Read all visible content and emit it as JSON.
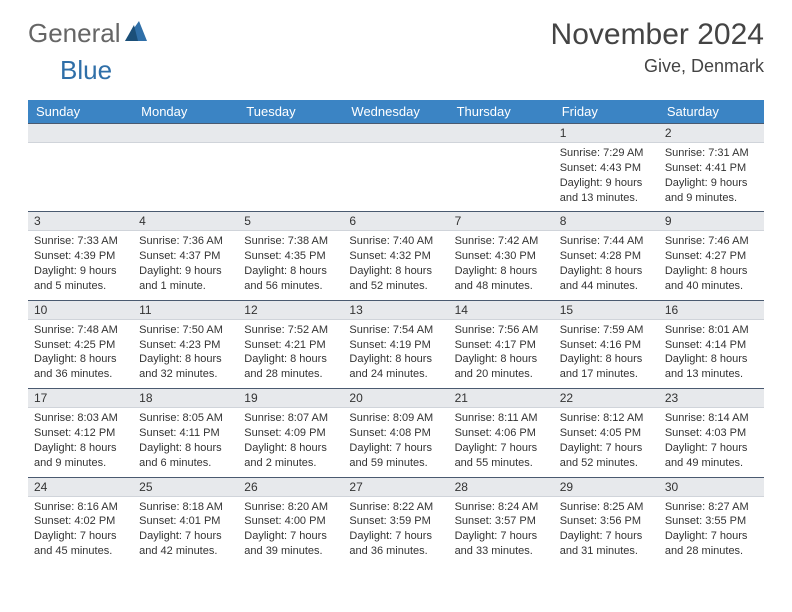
{
  "logo": {
    "word1": "General",
    "word2": "Blue"
  },
  "title": "November 2024",
  "location": "Give, Denmark",
  "daynames": [
    "Sunday",
    "Monday",
    "Tuesday",
    "Wednesday",
    "Thursday",
    "Friday",
    "Saturday"
  ],
  "weeks": [
    [
      {
        "n": "",
        "sr": "",
        "ss": "",
        "dl": ""
      },
      {
        "n": "",
        "sr": "",
        "ss": "",
        "dl": ""
      },
      {
        "n": "",
        "sr": "",
        "ss": "",
        "dl": ""
      },
      {
        "n": "",
        "sr": "",
        "ss": "",
        "dl": ""
      },
      {
        "n": "",
        "sr": "",
        "ss": "",
        "dl": ""
      },
      {
        "n": "1",
        "sr": "Sunrise: 7:29 AM",
        "ss": "Sunset: 4:43 PM",
        "dl": "Daylight: 9 hours and 13 minutes."
      },
      {
        "n": "2",
        "sr": "Sunrise: 7:31 AM",
        "ss": "Sunset: 4:41 PM",
        "dl": "Daylight: 9 hours and 9 minutes."
      }
    ],
    [
      {
        "n": "3",
        "sr": "Sunrise: 7:33 AM",
        "ss": "Sunset: 4:39 PM",
        "dl": "Daylight: 9 hours and 5 minutes."
      },
      {
        "n": "4",
        "sr": "Sunrise: 7:36 AM",
        "ss": "Sunset: 4:37 PM",
        "dl": "Daylight: 9 hours and 1 minute."
      },
      {
        "n": "5",
        "sr": "Sunrise: 7:38 AM",
        "ss": "Sunset: 4:35 PM",
        "dl": "Daylight: 8 hours and 56 minutes."
      },
      {
        "n": "6",
        "sr": "Sunrise: 7:40 AM",
        "ss": "Sunset: 4:32 PM",
        "dl": "Daylight: 8 hours and 52 minutes."
      },
      {
        "n": "7",
        "sr": "Sunrise: 7:42 AM",
        "ss": "Sunset: 4:30 PM",
        "dl": "Daylight: 8 hours and 48 minutes."
      },
      {
        "n": "8",
        "sr": "Sunrise: 7:44 AM",
        "ss": "Sunset: 4:28 PM",
        "dl": "Daylight: 8 hours and 44 minutes."
      },
      {
        "n": "9",
        "sr": "Sunrise: 7:46 AM",
        "ss": "Sunset: 4:27 PM",
        "dl": "Daylight: 8 hours and 40 minutes."
      }
    ],
    [
      {
        "n": "10",
        "sr": "Sunrise: 7:48 AM",
        "ss": "Sunset: 4:25 PM",
        "dl": "Daylight: 8 hours and 36 minutes."
      },
      {
        "n": "11",
        "sr": "Sunrise: 7:50 AM",
        "ss": "Sunset: 4:23 PM",
        "dl": "Daylight: 8 hours and 32 minutes."
      },
      {
        "n": "12",
        "sr": "Sunrise: 7:52 AM",
        "ss": "Sunset: 4:21 PM",
        "dl": "Daylight: 8 hours and 28 minutes."
      },
      {
        "n": "13",
        "sr": "Sunrise: 7:54 AM",
        "ss": "Sunset: 4:19 PM",
        "dl": "Daylight: 8 hours and 24 minutes."
      },
      {
        "n": "14",
        "sr": "Sunrise: 7:56 AM",
        "ss": "Sunset: 4:17 PM",
        "dl": "Daylight: 8 hours and 20 minutes."
      },
      {
        "n": "15",
        "sr": "Sunrise: 7:59 AM",
        "ss": "Sunset: 4:16 PM",
        "dl": "Daylight: 8 hours and 17 minutes."
      },
      {
        "n": "16",
        "sr": "Sunrise: 8:01 AM",
        "ss": "Sunset: 4:14 PM",
        "dl": "Daylight: 8 hours and 13 minutes."
      }
    ],
    [
      {
        "n": "17",
        "sr": "Sunrise: 8:03 AM",
        "ss": "Sunset: 4:12 PM",
        "dl": "Daylight: 8 hours and 9 minutes."
      },
      {
        "n": "18",
        "sr": "Sunrise: 8:05 AM",
        "ss": "Sunset: 4:11 PM",
        "dl": "Daylight: 8 hours and 6 minutes."
      },
      {
        "n": "19",
        "sr": "Sunrise: 8:07 AM",
        "ss": "Sunset: 4:09 PM",
        "dl": "Daylight: 8 hours and 2 minutes."
      },
      {
        "n": "20",
        "sr": "Sunrise: 8:09 AM",
        "ss": "Sunset: 4:08 PM",
        "dl": "Daylight: 7 hours and 59 minutes."
      },
      {
        "n": "21",
        "sr": "Sunrise: 8:11 AM",
        "ss": "Sunset: 4:06 PM",
        "dl": "Daylight: 7 hours and 55 minutes."
      },
      {
        "n": "22",
        "sr": "Sunrise: 8:12 AM",
        "ss": "Sunset: 4:05 PM",
        "dl": "Daylight: 7 hours and 52 minutes."
      },
      {
        "n": "23",
        "sr": "Sunrise: 8:14 AM",
        "ss": "Sunset: 4:03 PM",
        "dl": "Daylight: 7 hours and 49 minutes."
      }
    ],
    [
      {
        "n": "24",
        "sr": "Sunrise: 8:16 AM",
        "ss": "Sunset: 4:02 PM",
        "dl": "Daylight: 7 hours and 45 minutes."
      },
      {
        "n": "25",
        "sr": "Sunrise: 8:18 AM",
        "ss": "Sunset: 4:01 PM",
        "dl": "Daylight: 7 hours and 42 minutes."
      },
      {
        "n": "26",
        "sr": "Sunrise: 8:20 AM",
        "ss": "Sunset: 4:00 PM",
        "dl": "Daylight: 7 hours and 39 minutes."
      },
      {
        "n": "27",
        "sr": "Sunrise: 8:22 AM",
        "ss": "Sunset: 3:59 PM",
        "dl": "Daylight: 7 hours and 36 minutes."
      },
      {
        "n": "28",
        "sr": "Sunrise: 8:24 AM",
        "ss": "Sunset: 3:57 PM",
        "dl": "Daylight: 7 hours and 33 minutes."
      },
      {
        "n": "29",
        "sr": "Sunrise: 8:25 AM",
        "ss": "Sunset: 3:56 PM",
        "dl": "Daylight: 7 hours and 31 minutes."
      },
      {
        "n": "30",
        "sr": "Sunrise: 8:27 AM",
        "ss": "Sunset: 3:55 PM",
        "dl": "Daylight: 7 hours and 28 minutes."
      }
    ]
  ]
}
